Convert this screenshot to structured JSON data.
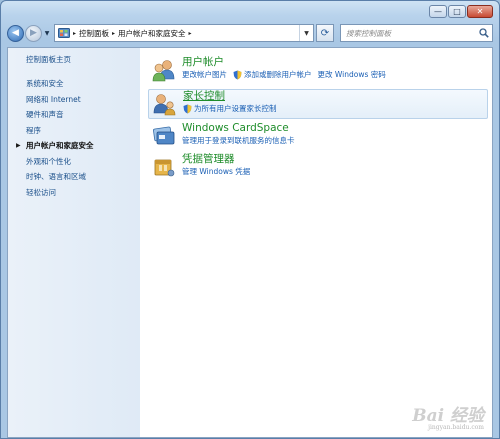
{
  "window": {
    "caption": {
      "minimize": "—",
      "maximize": "□",
      "close": "✕"
    }
  },
  "address_bar": {
    "crumbs": [
      "控制面板",
      "用户帐户和家庭安全"
    ],
    "search_placeholder": "搜索控制面板"
  },
  "sidebar": {
    "home": "控制面板主页",
    "items": [
      {
        "label": "系统和安全",
        "current": false
      },
      {
        "label": "网络和 Internet",
        "current": false
      },
      {
        "label": "硬件和声音",
        "current": false
      },
      {
        "label": "程序",
        "current": false
      },
      {
        "label": "用户帐户和家庭安全",
        "current": true
      },
      {
        "label": "外观和个性化",
        "current": false
      },
      {
        "label": "时钟、语言和区域",
        "current": false
      },
      {
        "label": "轻松访问",
        "current": false
      }
    ]
  },
  "categories": [
    {
      "title": "用户帐户",
      "icon": "users-icon",
      "links": [
        "更改帐户图片",
        "添加或删除用户帐户",
        "更改 Windows 密码"
      ]
    },
    {
      "title": "家长控制",
      "icon": "parental-controls-icon",
      "links": [
        "为所有用户设置家长控制"
      ]
    },
    {
      "title": "Windows CardSpace",
      "icon": "cardspace-icon",
      "links": [
        "管理用于登录到联机服务的信息卡"
      ]
    },
    {
      "title": "凭据管理器",
      "icon": "credential-manager-icon",
      "links": [
        "管理 Windows 凭据"
      ]
    }
  ],
  "watermark": {
    "main": "Bai 经验",
    "sub": "jingyan.baidu.com"
  },
  "colors": {
    "link": "#1a5fb4",
    "category_title": "#1e8c2a",
    "sidebar_bg": "#dfeaf6"
  }
}
